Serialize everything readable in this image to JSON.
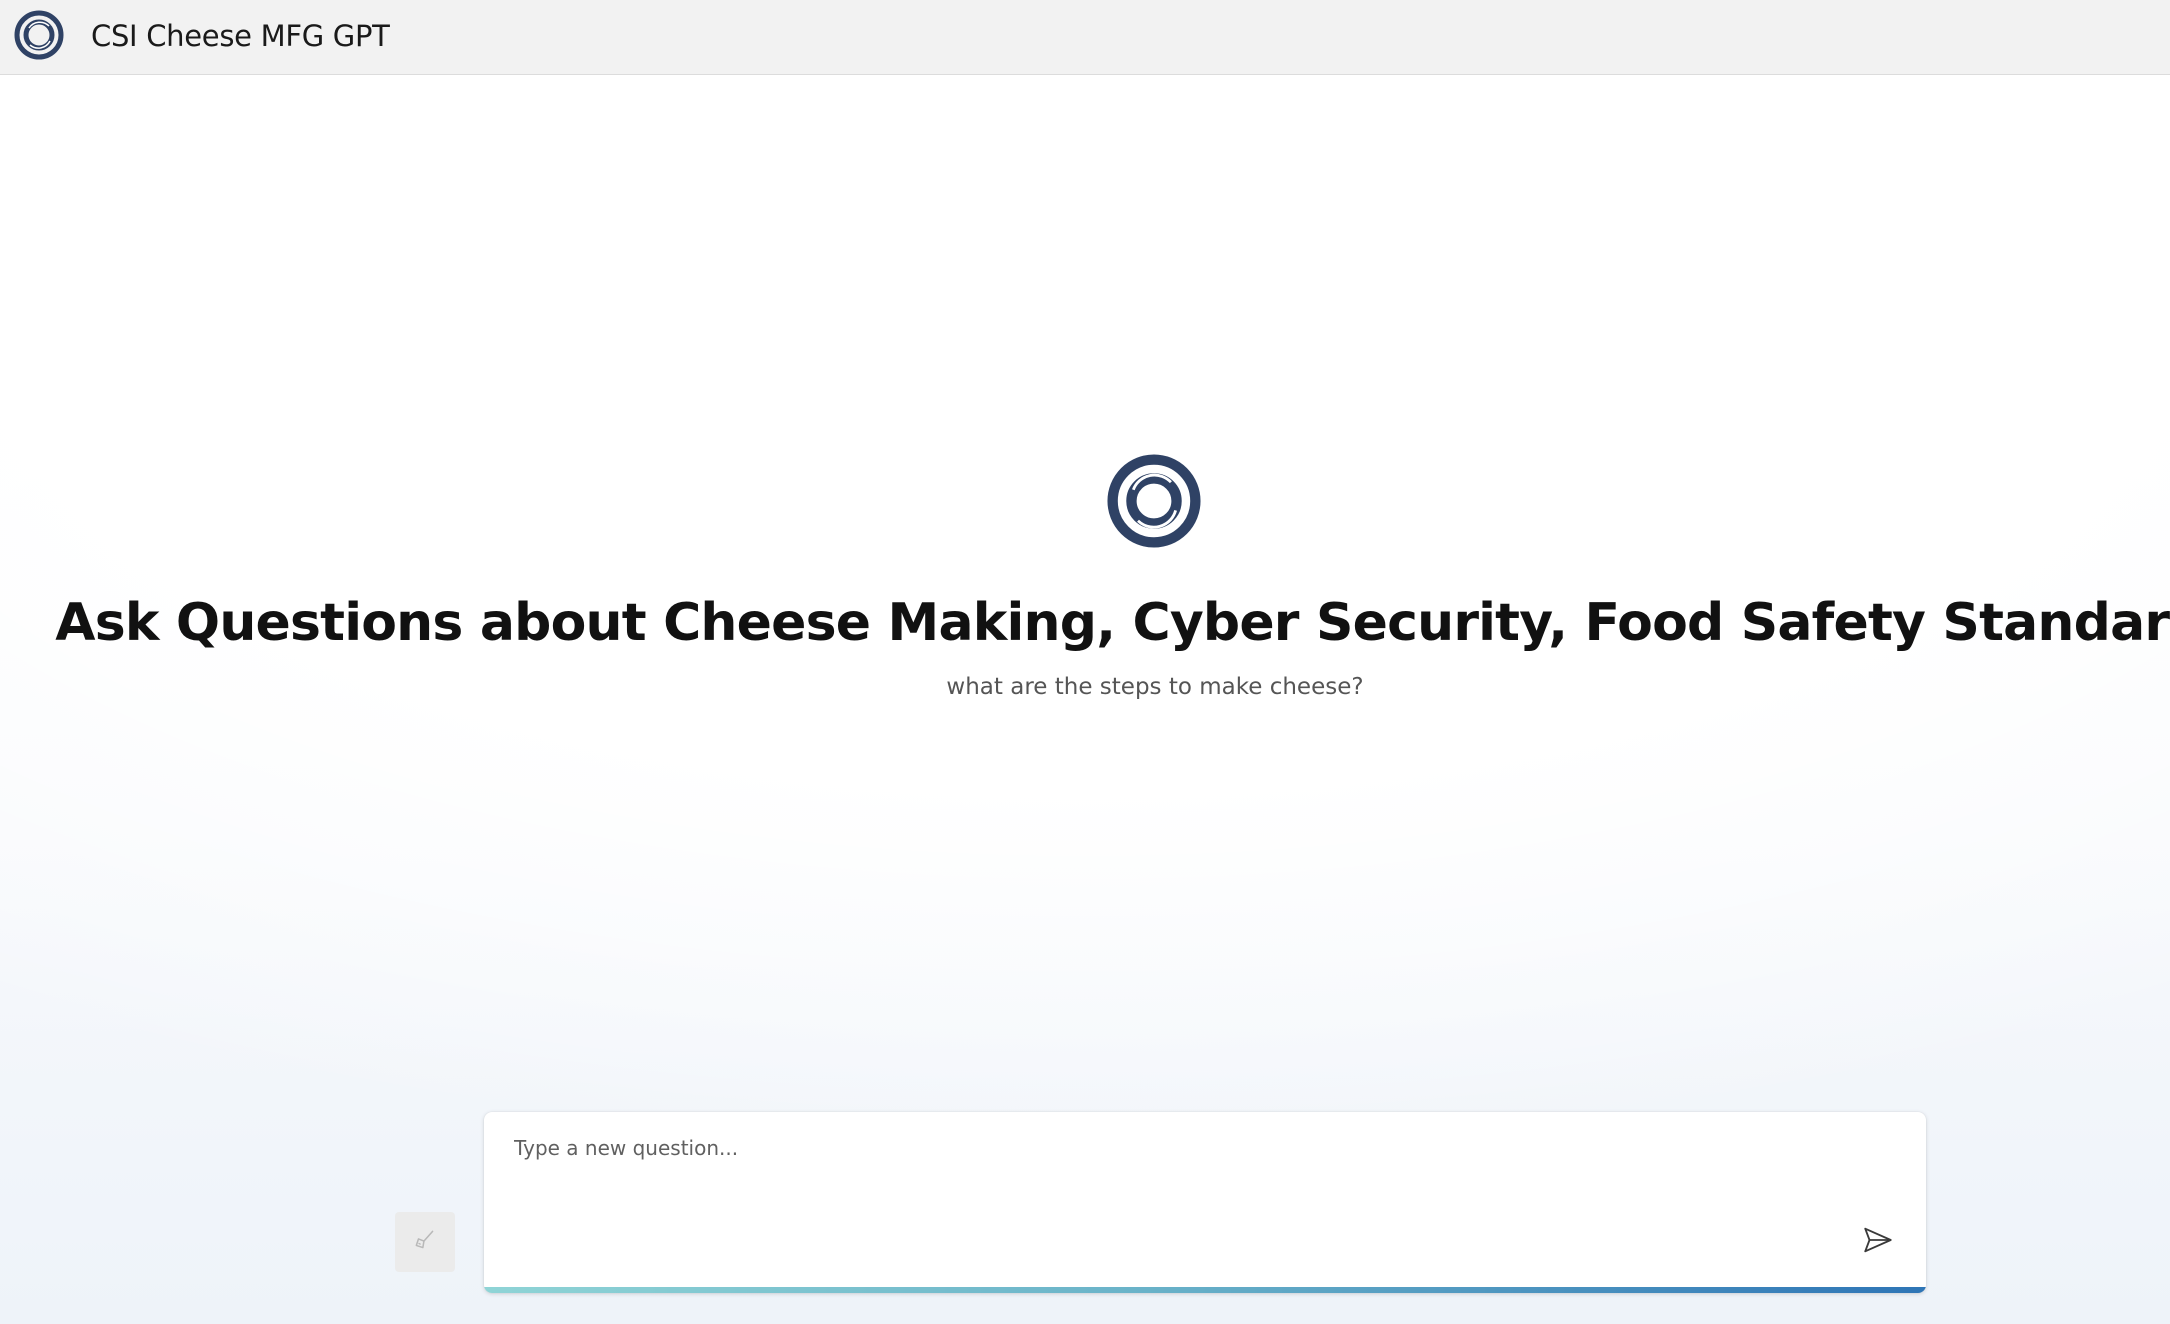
{
  "header": {
    "logo_icon": "ring-logo-icon",
    "title": "CSI Cheese MFG GPT"
  },
  "hero": {
    "logo_icon": "ring-logo-icon",
    "title": "Ask Questions about Cheese Making, Cyber Security, Food Safety Standards.",
    "example_question": "what are the steps to make cheese?"
  },
  "composer": {
    "clear_icon": "broom-icon",
    "placeholder": "Type a new question...",
    "send_icon": "send-icon"
  },
  "colors": {
    "logo": "#2f4265",
    "header_bg": "#f2f2f2",
    "accent_start": "#8fd4d6",
    "accent_end": "#2e75b6"
  }
}
